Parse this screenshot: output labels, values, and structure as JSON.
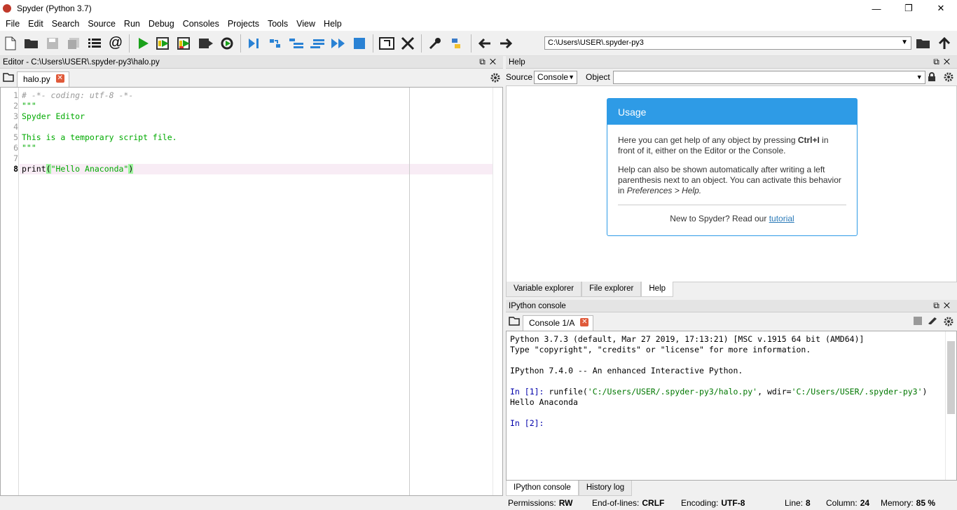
{
  "window": {
    "title": "Spyder (Python 3.7)",
    "min": "—",
    "max": "❐",
    "close": "✕"
  },
  "menu": [
    {
      "label": "File"
    },
    {
      "label": "Edit"
    },
    {
      "label": "Search"
    },
    {
      "label": "Source"
    },
    {
      "label": "Run"
    },
    {
      "label": "Debug"
    },
    {
      "label": "Consoles"
    },
    {
      "label": "Projects"
    },
    {
      "label": "Tools"
    },
    {
      "label": "View"
    },
    {
      "label": "Help"
    }
  ],
  "toolbar": {
    "path_value": "C:\\Users\\USER\\.spyder-py3",
    "icons": [
      "new-file-icon",
      "open-file-icon",
      "save-icon",
      "save-all-icon",
      "outline-icon",
      "at-icon",
      "run-icon",
      "run-cell-icon",
      "run-cell-advance-icon",
      "run-selection-icon",
      "rerun-icon",
      "debug-icon",
      "step-icon",
      "step-into-icon",
      "step-return-icon",
      "continue-icon",
      "stop-icon",
      "maximize-pane-icon",
      "fullscreen-icon",
      "preferences-icon",
      "python-path-icon",
      "back-icon",
      "forward-icon",
      "browse-folder-icon",
      "parent-dir-icon"
    ]
  },
  "editor": {
    "header": "Editor - C:\\Users\\USER\\.spyder-py3\\halo.py",
    "tab_label": "halo.py",
    "line_numbers": [
      "1",
      "2",
      "3",
      "4",
      "5",
      "6",
      "7",
      "8"
    ],
    "current_line": "8",
    "lines": {
      "l1": "# -*- coding: utf-8 -*-",
      "l2": "\"\"\"",
      "l3": "Spyder Editor",
      "l5": "This is a temporary script file.",
      "l6": "\"\"\"",
      "l8_fn": "print",
      "l8_open": "(",
      "l8_str": "\"Hello Anaconda\"",
      "l8_close": ")"
    }
  },
  "help": {
    "header": "Help",
    "source_label": "Source",
    "source_value": "Console",
    "object_label": "Object",
    "usage_title": "Usage",
    "p1_pre": "Here you can get help of any object by pressing ",
    "p1_key": "Ctrl+I",
    "p1_post": " in front of it, either on the Editor or the Console.",
    "p2_pre": "Help can also be shown automatically after writing a left parenthesis next to an object. You can activate this behavior in ",
    "p2_em": "Preferences > Help.",
    "footer_pre": "New to Spyder? Read our ",
    "footer_link": "tutorial",
    "tabs": [
      "Variable explorer",
      "File explorer",
      "Help"
    ]
  },
  "console": {
    "header": "IPython console",
    "tab_label": "Console 1/A",
    "out1": "Python 3.7.3 (default, Mar 27 2019, 17:13:21) [MSC v.1915 64 bit (AMD64)]",
    "out2": "Type \"copyright\", \"credits\" or \"license\" for more information.",
    "out3": "IPython 7.4.0 -- An enhanced Interactive Python.",
    "prompt1": "In [1]: ",
    "cmd_pre": "runfile(",
    "cmd_arg1": "'C:/Users/USER/.spyder-py3/halo.py'",
    "cmd_mid": ", wdir=",
    "cmd_arg2": "'C:/Users/USER/.spyder-py3'",
    "cmd_post": ")",
    "out4": "Hello Anaconda",
    "prompt2": "In [2]:",
    "tabs": [
      "IPython console",
      "History log"
    ]
  },
  "status": {
    "permissions_label": "Permissions:",
    "permissions": "RW",
    "eol_label": "End-of-lines:",
    "eol": "CRLF",
    "encoding_label": "Encoding:",
    "encoding": "UTF-8",
    "line_label": "Line:",
    "line": "8",
    "column_label": "Column:",
    "column": "24",
    "memory_label": "Memory:",
    "memory": "85 %"
  }
}
